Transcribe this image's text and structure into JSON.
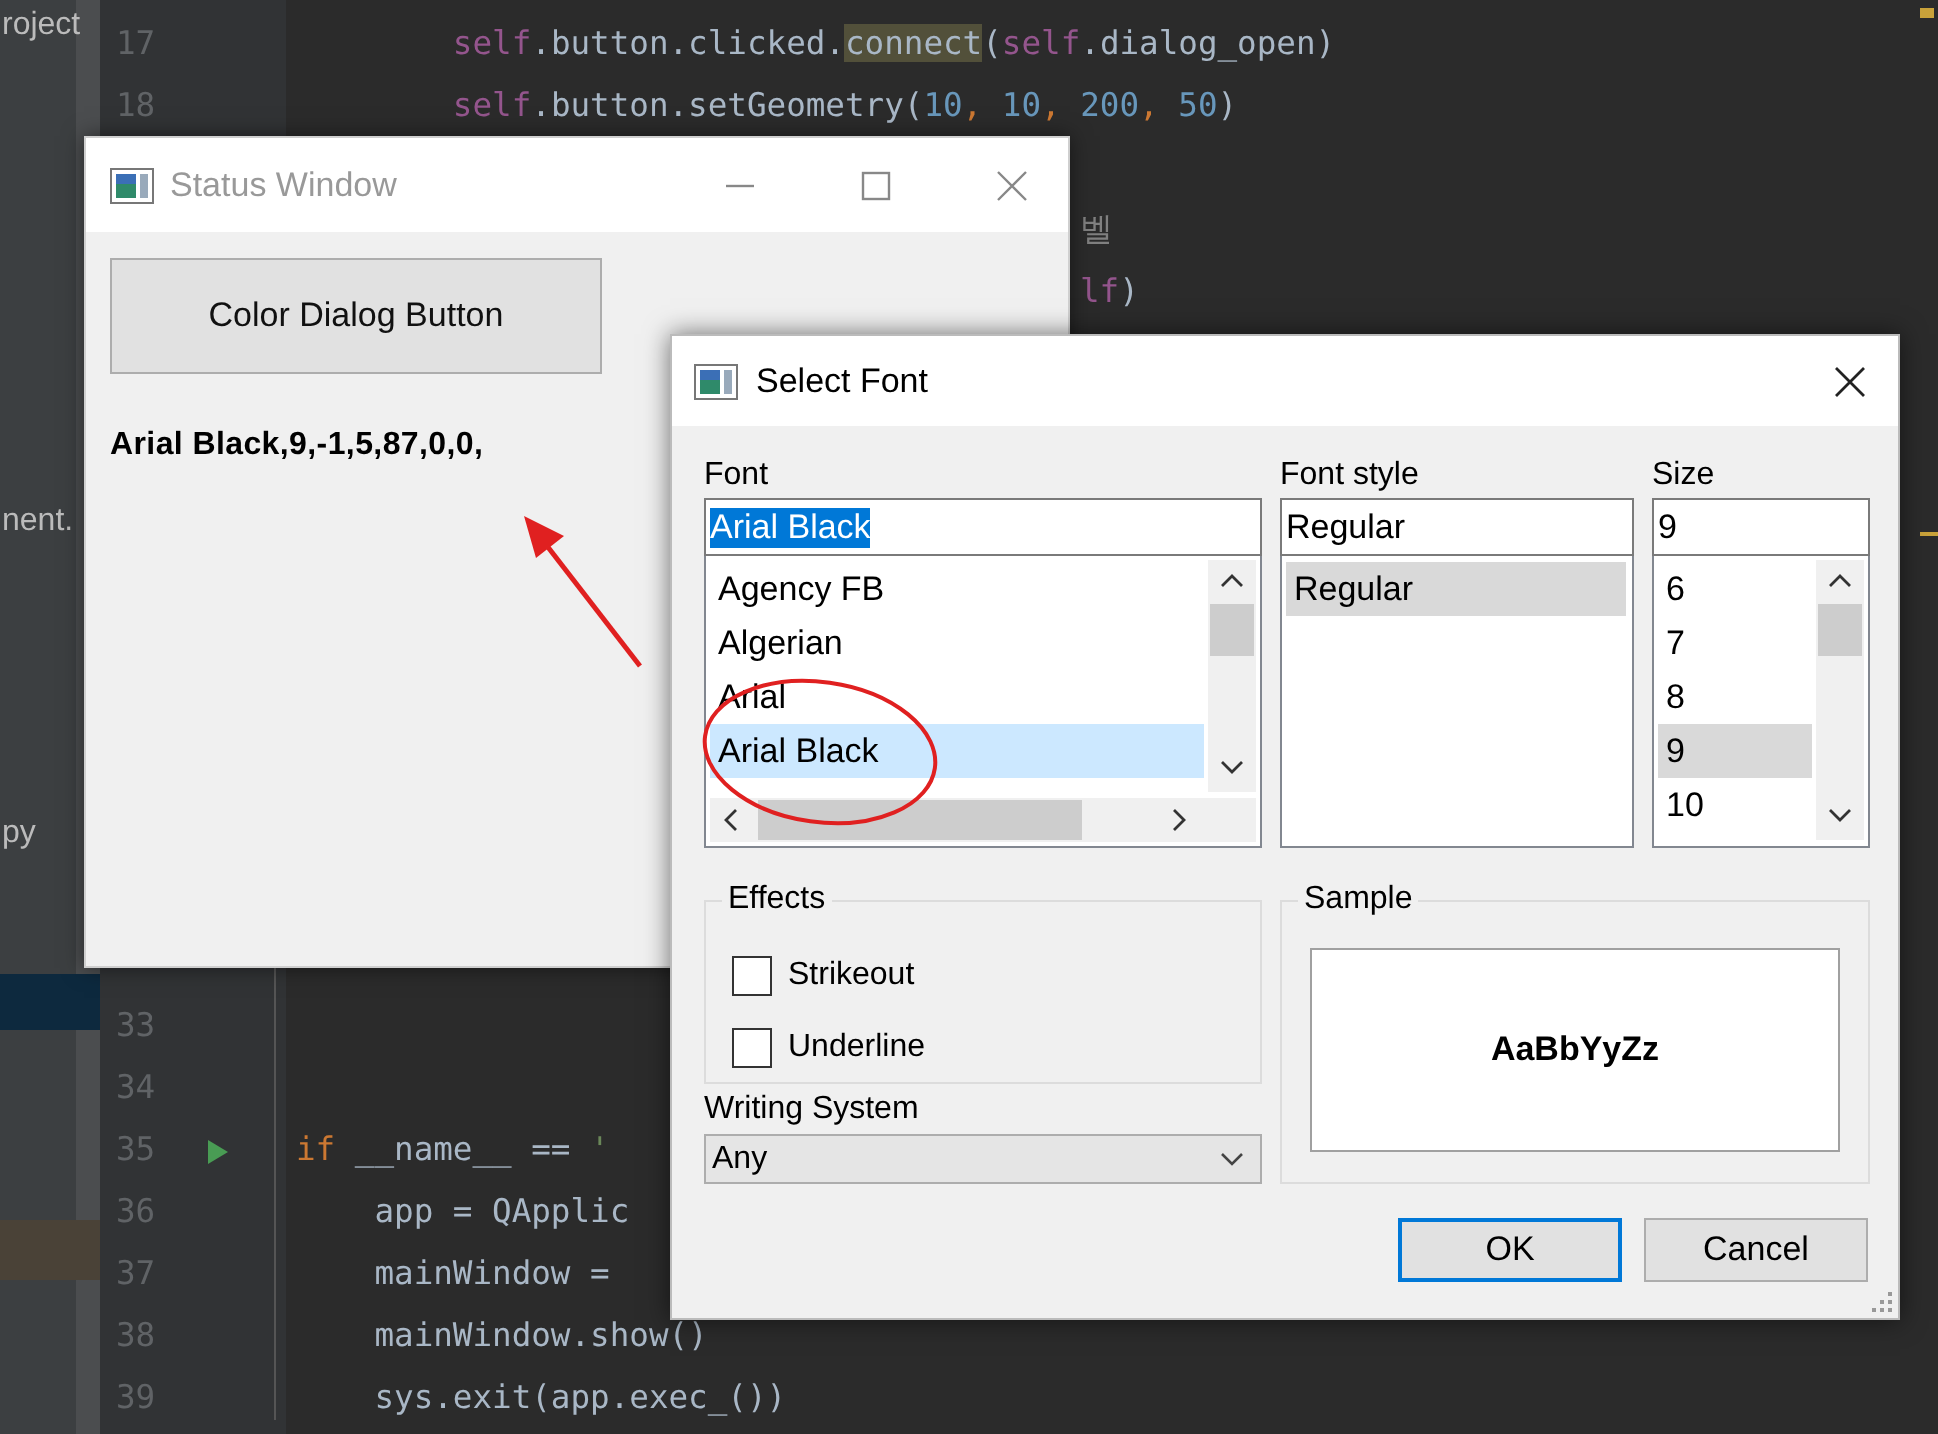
{
  "ide": {
    "project_panel": [
      {
        "label": "roject"
      },
      {
        "label": "nent."
      },
      {
        "label": "py"
      }
    ],
    "code_top": [
      {
        "number": "17",
        "tokens": [
          {
            "text": "        self",
            "kind": "self"
          },
          {
            "text": ".button.clicked.",
            "kind": "plain"
          },
          {
            "text": "connect",
            "kind": "highlight"
          },
          {
            "text": "(",
            "kind": "plain"
          },
          {
            "text": "self",
            "kind": "self"
          },
          {
            "text": ".dialog_open)",
            "kind": "plain"
          }
        ]
      },
      {
        "number": "18",
        "tokens": [
          {
            "text": "        self",
            "kind": "self"
          },
          {
            "text": ".button.setGeometry(",
            "kind": "plain"
          },
          {
            "text": "10",
            "kind": "number"
          },
          {
            "text": ", ",
            "kind": "keyword"
          },
          {
            "text": "10",
            "kind": "number"
          },
          {
            "text": ", ",
            "kind": "keyword"
          },
          {
            "text": "200",
            "kind": "number"
          },
          {
            "text": ", ",
            "kind": "keyword"
          },
          {
            "text": "50",
            "kind": "number"
          },
          {
            "text": ")",
            "kind": "plain"
          }
        ]
      }
    ],
    "code_fragments": [
      {
        "tokens": [
          {
            "text": "벨",
            "kind": "comment"
          }
        ]
      },
      {
        "tokens": [
          {
            "text": "lf",
            "kind": "self"
          },
          {
            "text": ")",
            "kind": "plain"
          }
        ]
      }
    ],
    "code_bottom": [
      {
        "number": "33"
      },
      {
        "number": "34"
      },
      {
        "number": "35",
        "run": true,
        "tokens": [
          {
            "text": "if",
            "kind": "keyword"
          },
          {
            "text": " __name__ == ",
            "kind": "plain"
          },
          {
            "text": "'",
            "kind": "string"
          }
        ]
      },
      {
        "number": "36",
        "tokens": [
          {
            "text": "    app = QApplic",
            "kind": "plain"
          }
        ]
      },
      {
        "number": "37",
        "tokens": [
          {
            "text": "    mainWindow =",
            "kind": "plain"
          }
        ]
      },
      {
        "number": "38",
        "tokens": [
          {
            "text": "    mainWindow.show()",
            "kind": "plain"
          }
        ]
      },
      {
        "number": "39",
        "tokens": [
          {
            "text": "    sys.exit(app.exec_())",
            "kind": "plain"
          }
        ]
      }
    ]
  },
  "status_window": {
    "title": "Status Window",
    "button": "Color Dialog Button",
    "label": "Arial Black,9,-1,5,87,0,0,"
  },
  "font_dialog": {
    "title": "Select Font",
    "columns": [
      {
        "label": "Font",
        "value": "Arial Black",
        "value_selected": true,
        "focused": true,
        "hscroll": true,
        "items": [
          {
            "label": "Agency FB",
            "selected": false
          },
          {
            "label": "Algerian",
            "selected": false
          },
          {
            "label": "Arial",
            "selected": false
          },
          {
            "label": "Arial Black",
            "selected": true
          }
        ]
      },
      {
        "label": "Font style",
        "value": "Regular",
        "value_selected": false,
        "focused": false,
        "hscroll": false,
        "items": [
          {
            "label": "Regular",
            "selected": true
          }
        ]
      },
      {
        "label": "Size",
        "value": "9",
        "value_selected": false,
        "focused": false,
        "hscroll": false,
        "items": [
          {
            "label": "6",
            "selected": false
          },
          {
            "label": "7",
            "selected": false
          },
          {
            "label": "8",
            "selected": false
          },
          {
            "label": "9",
            "selected": true
          },
          {
            "label": "10",
            "selected": false
          }
        ]
      }
    ],
    "effects": {
      "label": "Effects",
      "options": [
        {
          "label": "Strikeout",
          "checked": false
        },
        {
          "label": "Underline",
          "checked": false
        }
      ]
    },
    "writing_system": {
      "label": "Writing System",
      "value": "Any"
    },
    "sample": {
      "label": "Sample",
      "text": "AaBbYyZz"
    },
    "buttons": [
      {
        "label": "OK",
        "default": true
      },
      {
        "label": "Cancel",
        "default": false
      }
    ]
  }
}
